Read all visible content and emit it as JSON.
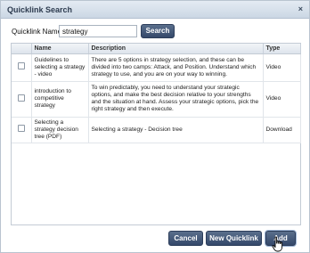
{
  "dialog": {
    "title": "Quicklink Search",
    "close_label": "×"
  },
  "search": {
    "label": "Quicklink Name",
    "value": "strategy",
    "button_label": "Search"
  },
  "table": {
    "headers": [
      "",
      "Name",
      "Description",
      "Type"
    ],
    "rows": [
      {
        "name": "Guidelines to selecting a strategy - video",
        "description": "There are 5 options in strategy selection, and these can be divided into two camps: Attack, and Position. Understand which strategy to use, and you are on your way to winning.",
        "type": "Video",
        "checked": false
      },
      {
        "name": "introduction to competitive strategy",
        "description": "To win predictably, you need to understand your strategic options, and make the best decision relative to your strengths and the situation at hand. Assess your strategic options, pick the right strategy and then execute.",
        "type": "Video",
        "checked": false
      },
      {
        "name": "Selecting a strategy decision tree (PDF)",
        "description": "Selecting a strategy - Decision tree",
        "type": "Download",
        "checked": false
      }
    ]
  },
  "footer": {
    "cancel_label": "Cancel",
    "new_label": "New Quicklink",
    "add_label": "Add"
  }
}
